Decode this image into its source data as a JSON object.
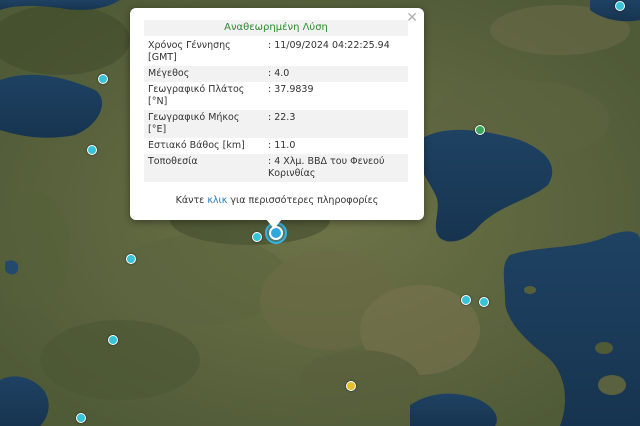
{
  "popup": {
    "title": "Αναθεωρημένη Λύση",
    "close_glyph": "✕",
    "rows": [
      {
        "label": "Χρόνος Γέννησης [GMT]",
        "value": ": 11/09/2024 04:22:25.94"
      },
      {
        "label": "Μέγεθος",
        "value": ": 4.0"
      },
      {
        "label": "Γεωγραφικό Πλάτος [°N]",
        "value": ": 37.9839"
      },
      {
        "label": "Γεωγραφικό Μήκος [°E]",
        "value": ": 22.3"
      },
      {
        "label": "Εστιακό Βάθος [km]",
        "value": ": 11.0"
      },
      {
        "label": "Τοποθεσία",
        "value": ": 4 Χλμ. ΒΒΔ του Φενεού Κορινθίας"
      }
    ],
    "more_prefix": "Κάντε",
    "more_link": "κλικ",
    "more_suffix": "για περισσότερες πληροφορίες"
  },
  "markers": [
    {
      "name": "quake-marker",
      "color": "#38c4d8"
    },
    {
      "name": "quake-marker",
      "color": "#38c4d8"
    },
    {
      "name": "quake-marker",
      "color": "#3aa85a"
    },
    {
      "name": "quake-marker",
      "color": "#38c4d8"
    },
    {
      "name": "quake-marker",
      "color": "#38c4d8"
    },
    {
      "name": "quake-marker",
      "color": "#38c4d8"
    },
    {
      "name": "quake-marker",
      "color": "#38c4d8"
    },
    {
      "name": "quake-marker",
      "color": "#38c4d8"
    },
    {
      "name": "quake-marker",
      "color": "#38c4d8"
    },
    {
      "name": "quake-marker",
      "color": "#e3c02e"
    },
    {
      "name": "quake-marker",
      "color": "#38c4d8"
    }
  ],
  "epicenter_color": "#2ea9e0"
}
